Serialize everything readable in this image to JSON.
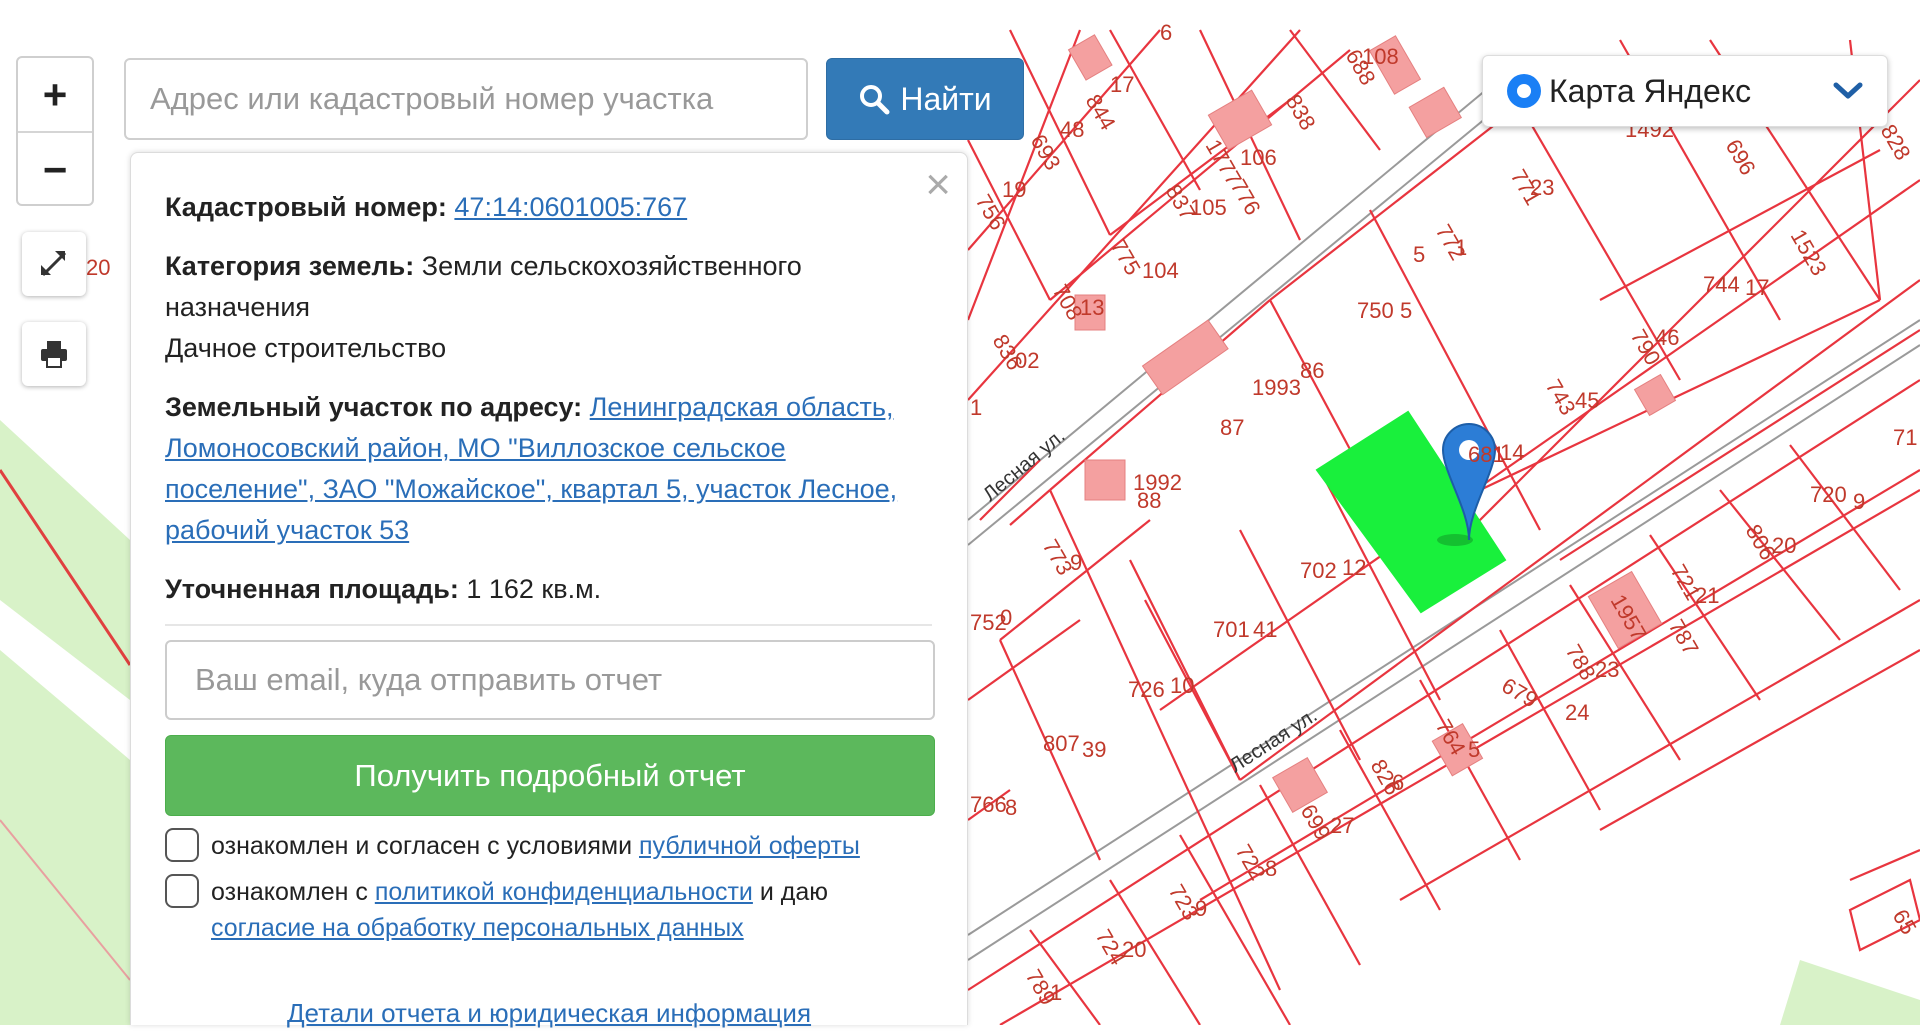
{
  "map": {
    "provider": "Карта Яндекс",
    "lot_color": "#e8353f",
    "selected_color": "#19f03c",
    "street_names": [
      "Лесная ул.",
      "Лесная ул."
    ],
    "lot_labels": [
      "844",
      "17",
      "693",
      "48",
      "756",
      "19",
      "1777",
      "776",
      "106",
      "838",
      "688",
      "108",
      "837",
      "105",
      "775",
      "104",
      "708",
      "13",
      "836",
      "02",
      "750",
      "5",
      "772",
      "1",
      "771",
      "23",
      "1492",
      "696",
      "1523",
      "828",
      "744",
      "17",
      "790",
      "46",
      "743",
      "45",
      "1993",
      "86",
      "87",
      "681",
      "14",
      "1992",
      "88",
      "773",
      "9",
      "702",
      "12",
      "701",
      "41",
      "726",
      "10",
      "807",
      "39",
      "720",
      "9",
      "806",
      "20",
      "721",
      "21",
      "1957",
      "787",
      "788",
      "23",
      "679",
      "24",
      "764",
      "5",
      "826",
      "6",
      "699",
      "27",
      "722",
      "8",
      "723",
      "9",
      "724",
      "20",
      "789",
      "1",
      "752",
      "0",
      "766",
      "8",
      "20",
      "71",
      "65",
      "1",
      "5",
      "6"
    ]
  },
  "controls": {
    "zoom_in": "+",
    "zoom_out": "−"
  },
  "search": {
    "placeholder": "Адрес или кадастровый номер участка",
    "button_label": "Найти"
  },
  "layer_select": {
    "selected": "Карта Яндекс"
  },
  "info": {
    "cadastral_label": "Кадастровый номер:",
    "cadastral_number": "47:14:0601005:767",
    "category_label": "Категория земель:",
    "category_value": "Земли сельскохозяйственного назначения",
    "usage": "Дачное строительство",
    "address_label": "Земельный участок по адресу:",
    "address_value": "Ленинградская область, Ломоносовский район, МО \"Виллозское сельское поселение\", ЗАО \"Можайское\", квартал 5, участок Лесное, рабочий участок 53",
    "area_label": "Уточненная площадь:",
    "area_value": "1 162 кв.м."
  },
  "report": {
    "email_placeholder": "Ваш email, куда отправить отчет",
    "button_label": "Получить подробный отчет",
    "agree1_text": "ознакомлен и согласен с условиями",
    "agree1_link": "публичной оферты",
    "agree2_text_a": "ознакомлен с",
    "agree2_link_a": "политикой конфиденциальности",
    "agree2_text_b": "и даю",
    "agree2_link_b": "согласие на обработку персональных данных",
    "details_link": "Детали отчета и юридическая информация"
  }
}
